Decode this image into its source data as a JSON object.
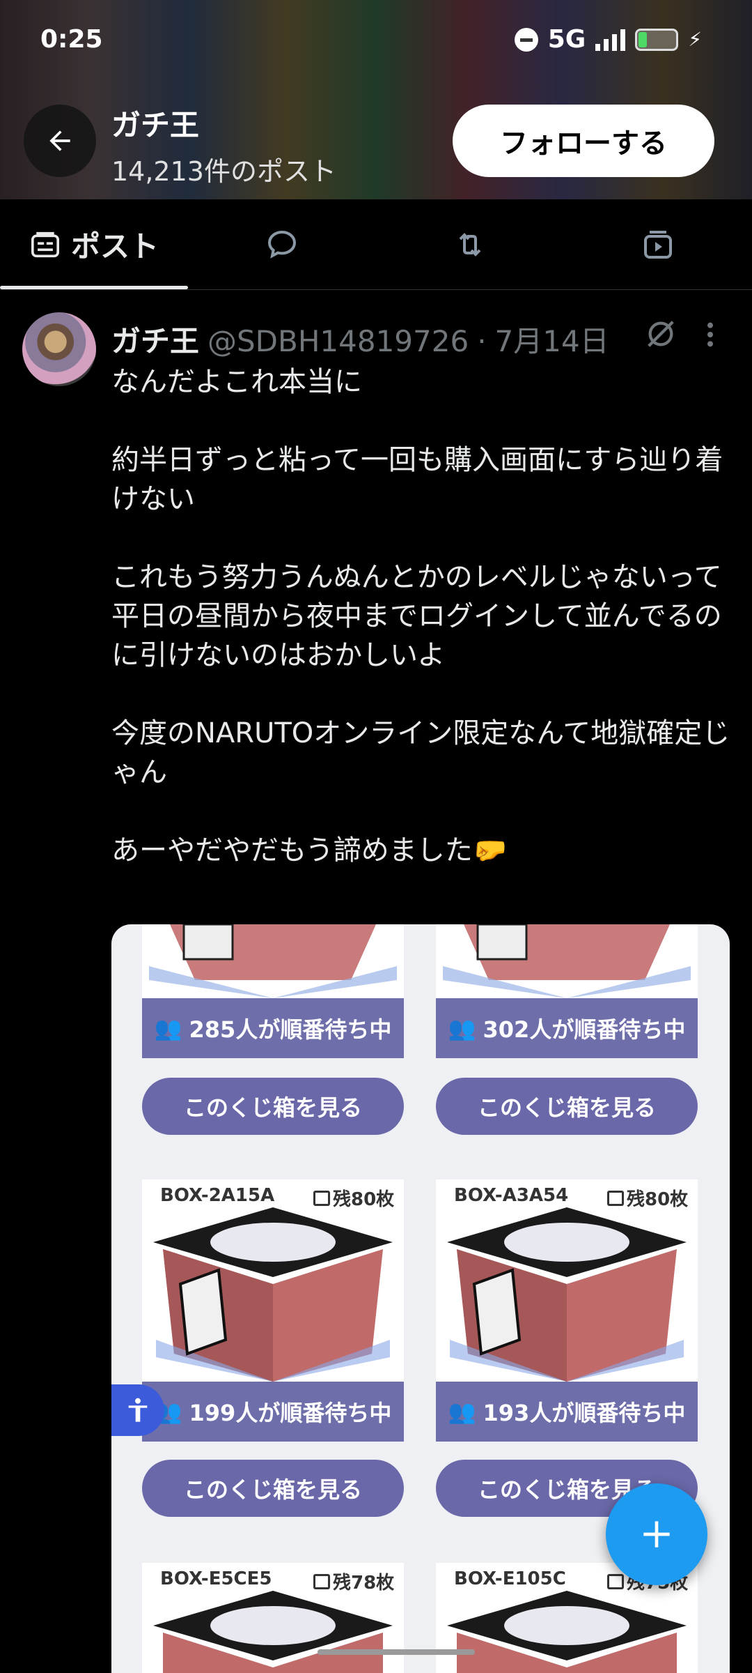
{
  "status_bar": {
    "time": "0:25",
    "network": "5G"
  },
  "header": {
    "title": "ガチ王",
    "post_count": "14,213件のポスト",
    "follow_label": "フォローする"
  },
  "tabs": [
    {
      "label": "ポスト",
      "icon": "posts-icon",
      "active": true
    },
    {
      "label": "",
      "icon": "replies-icon",
      "active": false
    },
    {
      "label": "",
      "icon": "repost-icon",
      "active": false
    },
    {
      "label": "",
      "icon": "media-icon",
      "active": false
    }
  ],
  "post": {
    "author_name": "ガチ王",
    "handle": "@SDBH14819726",
    "separator": "·",
    "date": "7月14日",
    "text_lines": [
      "なんだよこれ本当に",
      "",
      "約半日ずっと粘って一回も購入画面にすら辿り着けない",
      "",
      "これもう努力うんぬんとかのレベルじゃないって",
      "平日の昼間から夜中までログインして並んでるのに引けないのはおかしいよ",
      "",
      "今度のNARUTOオンライン限定なんて地獄確定じゃん",
      "",
      "あーやだやだもう諦めました🤛"
    ]
  },
  "media": {
    "view_label": "このくじ箱を見る",
    "rows": [
      {
        "left": {
          "id": "",
          "remain": "",
          "queue": "285人が順番待ち中"
        },
        "right": {
          "id": "",
          "remain": "",
          "queue": "302人が順番待ち中"
        }
      },
      {
        "left": {
          "id": "BOX-2A15A",
          "remain": "残80枚",
          "queue": "199人が順番待ち中"
        },
        "right": {
          "id": "BOX-A3A54",
          "remain": "残80枚",
          "queue": "193人が順番待ち中"
        }
      },
      {
        "left": {
          "id": "BOX-E5CE5",
          "remain": "残78枚",
          "queue": ""
        },
        "right": {
          "id": "BOX-E105C",
          "remain": "残75枚",
          "queue": ""
        }
      }
    ]
  },
  "colors": {
    "accent": "#1d9bf0",
    "queue_bg": "#6e6eaa",
    "background": "#000000"
  }
}
